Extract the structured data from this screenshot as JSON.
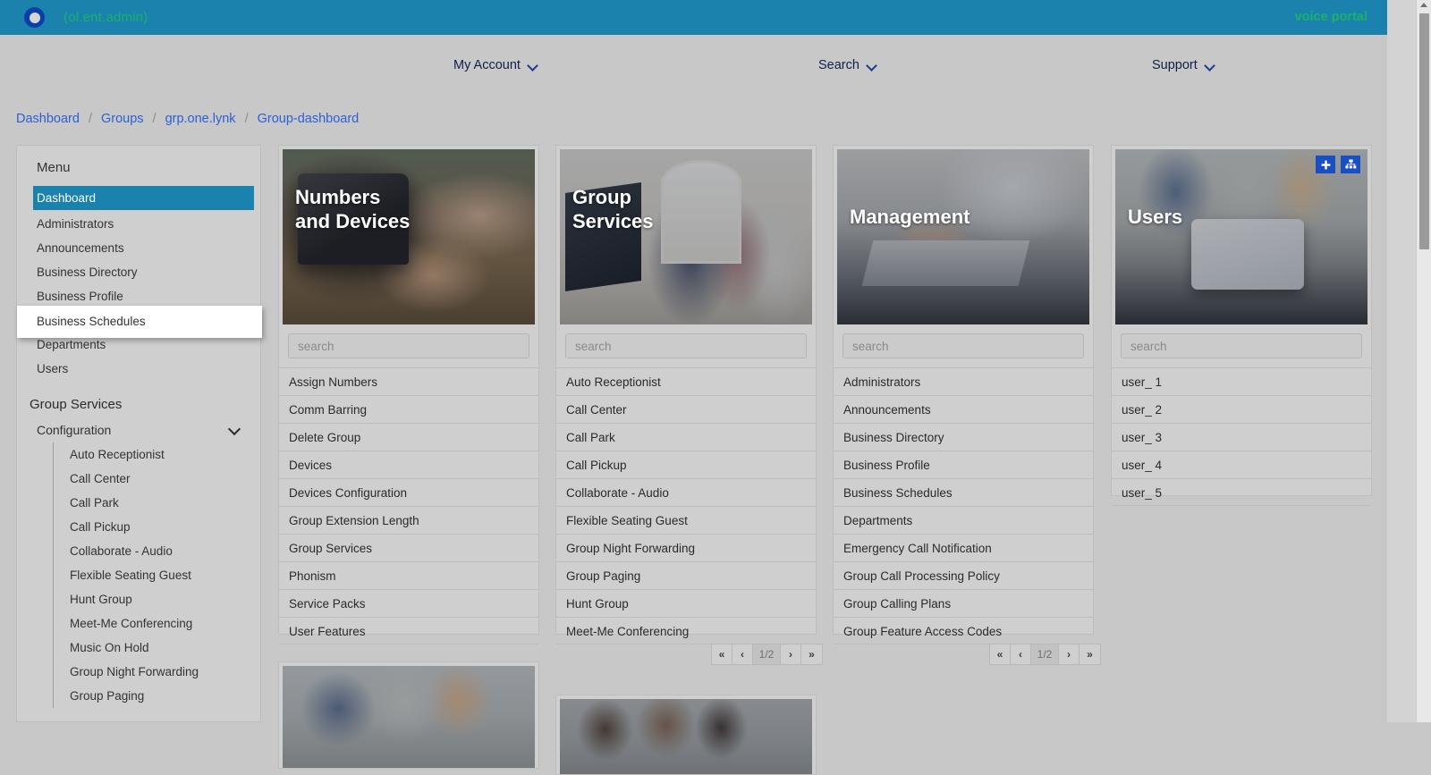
{
  "topbar": {
    "username": "(ol.ent.admin)",
    "voice_portal": "voice portal",
    "logo_icon": "circle-logo-icon"
  },
  "nav": {
    "items": [
      {
        "label": "My Account",
        "icon": "chevron-down-icon"
      },
      {
        "label": "Search",
        "icon": "chevron-down-icon"
      },
      {
        "label": "Support",
        "icon": "chevron-down-icon"
      }
    ]
  },
  "breadcrumb": {
    "items": [
      "Dashboard",
      "Groups",
      "grp.one.lynk",
      "Group-dashboard"
    ],
    "separator": "/"
  },
  "sidebar": {
    "title": "Menu",
    "items": [
      {
        "label": "Dashboard",
        "state": "active"
      },
      {
        "label": "Administrators",
        "state": "normal"
      },
      {
        "label": "Announcements",
        "state": "normal"
      },
      {
        "label": "Business Directory",
        "state": "normal"
      },
      {
        "label": "Business Profile",
        "state": "normal"
      },
      {
        "label": "Business Schedules",
        "state": "hovered"
      },
      {
        "label": "Departments",
        "state": "normal"
      },
      {
        "label": "Users",
        "state": "normal"
      }
    ],
    "group_services_heading": "Group Services",
    "configuration_label": "Configuration",
    "configuration_icon": "chevron-down-icon",
    "configuration_items": [
      "Auto Receptionist",
      "Call Center",
      "Call Park",
      "Call Pickup",
      "Collaborate - Audio",
      "Flexible Seating Guest",
      "Hunt Group",
      "Meet-Me Conferencing",
      "Music On Hold",
      "Group Night Forwarding",
      "Group Paging"
    ]
  },
  "cards": [
    {
      "title": "Numbers\nand Devices",
      "title_line1": "Numbers",
      "title_line2": "and Devices",
      "search_placeholder": "search",
      "search_value": "",
      "items": [
        "Assign Numbers",
        "Comm Barring",
        "Delete Group",
        "Devices",
        "Devices Configuration",
        "Group Extension Length",
        "Group Services",
        "Phonism",
        "Service Packs",
        "User Features"
      ],
      "pager": null,
      "corner_buttons": []
    },
    {
      "title_line1": "Group",
      "title_line2": "Services",
      "search_placeholder": "search",
      "search_value": "",
      "items": [
        "Auto Receptionist",
        "Call Center",
        "Call Park",
        "Call Pickup",
        "Collaborate - Audio",
        "Flexible Seating Guest",
        "Group Night Forwarding",
        "Group Paging",
        "Hunt Group",
        "Meet-Me Conferencing"
      ],
      "pager": {
        "first": "«",
        "prev": "‹",
        "page": "1/2",
        "next": "›",
        "last": "»"
      },
      "corner_buttons": []
    },
    {
      "title_line1": "Management",
      "title_line2": "",
      "search_placeholder": "search",
      "search_value": "",
      "items": [
        "Administrators",
        "Announcements",
        "Business Directory",
        "Business Profile",
        "Business Schedules",
        "Departments",
        "Emergency Call Notification",
        "Group Call Processing Policy",
        "Group Calling Plans",
        "Group Feature Access Codes"
      ],
      "pager": {
        "first": "«",
        "prev": "‹",
        "page": "1/2",
        "next": "›",
        "last": "»"
      },
      "corner_buttons": []
    },
    {
      "title_line1": "Users",
      "title_line2": "",
      "search_placeholder": "search",
      "search_value": "",
      "items": [
        "user_ 1",
        "user_ 2",
        "user_ 3",
        "user_ 4",
        "user_ 5"
      ],
      "pager": null,
      "corner_buttons": [
        {
          "icon": "plus-icon",
          "name": "add-user-button"
        },
        {
          "icon": "org-chart-icon",
          "name": "user-hierarchy-button"
        }
      ]
    }
  ],
  "colors": {
    "brand_blue": "#1b82ae",
    "brand_green": "#17b36a",
    "link_blue": "#2b5fd9",
    "button_blue": "#1a4fc4",
    "page_bg": "#c8c8c8"
  }
}
